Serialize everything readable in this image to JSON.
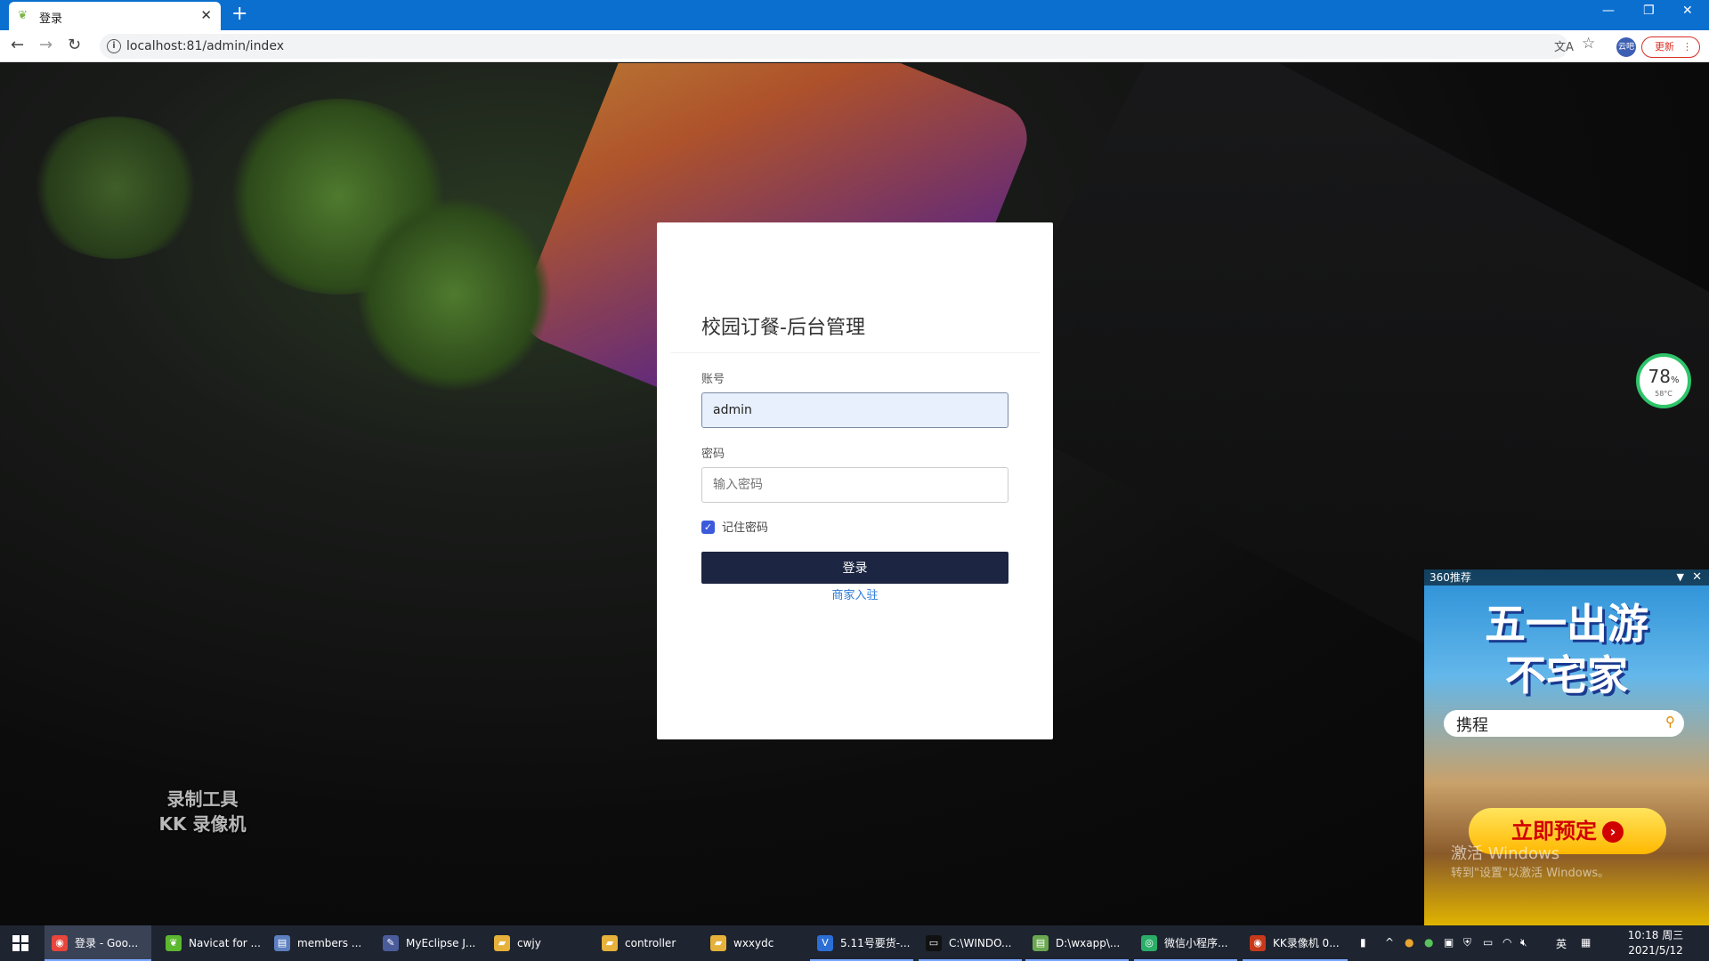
{
  "browser": {
    "tab_title": "登录",
    "url": "localhost:81/admin/index",
    "profile_label": "云吧",
    "update_label": "更新"
  },
  "login": {
    "title": "校园订餐-后台管理",
    "account_label": "账号",
    "account_value": "admin",
    "password_label": "密码",
    "password_placeholder": "输入密码",
    "remember_label": "记住密码",
    "remember_checked": true,
    "login_button": "登录",
    "merchant_link": "商家入驻"
  },
  "watermark": {
    "line1": "录制工具",
    "line2": "KK 录像机"
  },
  "system_widget": {
    "usage": "78",
    "unit": "%",
    "temp": "58°C"
  },
  "ad": {
    "header": "360推荐",
    "title_line1": "五一出游",
    "title_line2": "不宅家",
    "search_text": "携程",
    "cta": "立即预定",
    "activate_line1": "激活 Windows",
    "activate_line2": "转到\"设置\"以激活 Windows。"
  },
  "taskbar": {
    "items": [
      {
        "label": "登录 - Goo...",
        "icon": "chrome-icon",
        "color": "#e8453c"
      },
      {
        "label": "Navicat for ...",
        "icon": "navicat-icon",
        "color": "#5cb82e"
      },
      {
        "label": "members ...",
        "icon": "table-icon",
        "color": "#5b7fbf"
      },
      {
        "label": "MyEclipse J...",
        "icon": "eclipse-icon",
        "color": "#4b5c9a"
      },
      {
        "label": "cwjy",
        "icon": "folder-icon",
        "color": "#e6b23b"
      },
      {
        "label": "controller",
        "icon": "folder-icon",
        "color": "#e6b23b"
      },
      {
        "label": "wxxydc",
        "icon": "folder-icon",
        "color": "#e6b23b"
      },
      {
        "label": "5.11号要货-...",
        "icon": "doc-icon",
        "color": "#2b6fd6"
      },
      {
        "label": "C:\\WINDO...",
        "icon": "cmd-icon",
        "color": "#111"
      },
      {
        "label": "D:\\wxapp\\...",
        "icon": "notepad-icon",
        "color": "#6aa84f"
      },
      {
        "label": "微信小程序...",
        "icon": "wechat-dev-icon",
        "color": "#2aae67"
      },
      {
        "label": "KK录像机 0...",
        "icon": "kk-recorder-icon",
        "color": "#c7391b"
      }
    ],
    "ime": "英",
    "time": "10:18 周三",
    "date": "2021/5/12"
  }
}
